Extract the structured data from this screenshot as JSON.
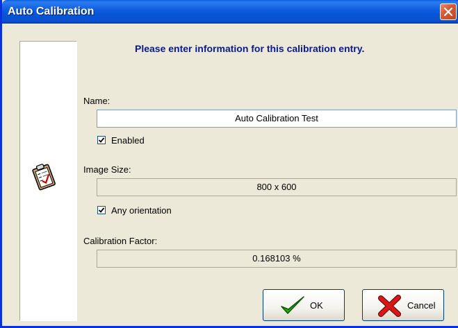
{
  "window": {
    "title": "Auto Calibration"
  },
  "heading": "Please enter information for this calibration entry.",
  "name": {
    "label": "Name:",
    "value": "Auto Calibration Test"
  },
  "enabled": {
    "label": "Enabled",
    "checked": true
  },
  "image_size": {
    "label": "Image Size:",
    "value": "800 x 600"
  },
  "any_orientation": {
    "label": "Any orientation",
    "checked": true
  },
  "calibration_factor": {
    "label": "Calibration Factor:",
    "value": "0.168103 %"
  },
  "buttons": {
    "ok": "OK",
    "cancel": "Cancel"
  },
  "icons": {
    "side": "clipboard-checklist-icon",
    "ok": "green-checkmark-icon",
    "cancel": "red-x-icon"
  },
  "colors": {
    "titlebar": "#0a5fdc",
    "heading": "#0a1a8c",
    "client": "#ece9d8"
  }
}
